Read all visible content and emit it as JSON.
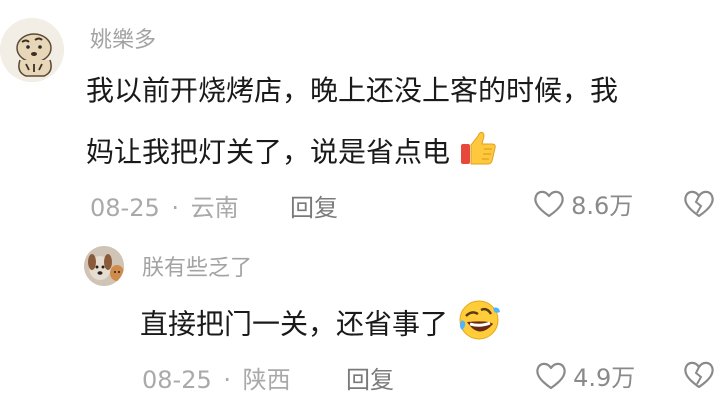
{
  "comments": [
    {
      "username": "姚樂多",
      "text_line1": "我以前开烧烤店，晚上还没上客的时候，我",
      "text_line2": "妈让我把灯关了，说是省点电",
      "emoji": "thumbs-up",
      "date": "08-25",
      "separator": "·",
      "location": "云南",
      "reply_label": "回复",
      "like_count": "8.6万"
    },
    {
      "username": "朕有些乏了",
      "text_line1": "直接把门一关，还省事了",
      "emoji": "rolling-on-floor-laughing",
      "date": "08-25",
      "separator": "·",
      "location": "陕西",
      "reply_label": "回复",
      "like_count": "4.9万"
    }
  ],
  "icons": {
    "like": "heart-outline-icon",
    "dislike": "broken-heart-icon"
  },
  "colors": {
    "text": "#1a1a1a",
    "username": "#a3a3a3",
    "meta": "#a9a9a9"
  }
}
